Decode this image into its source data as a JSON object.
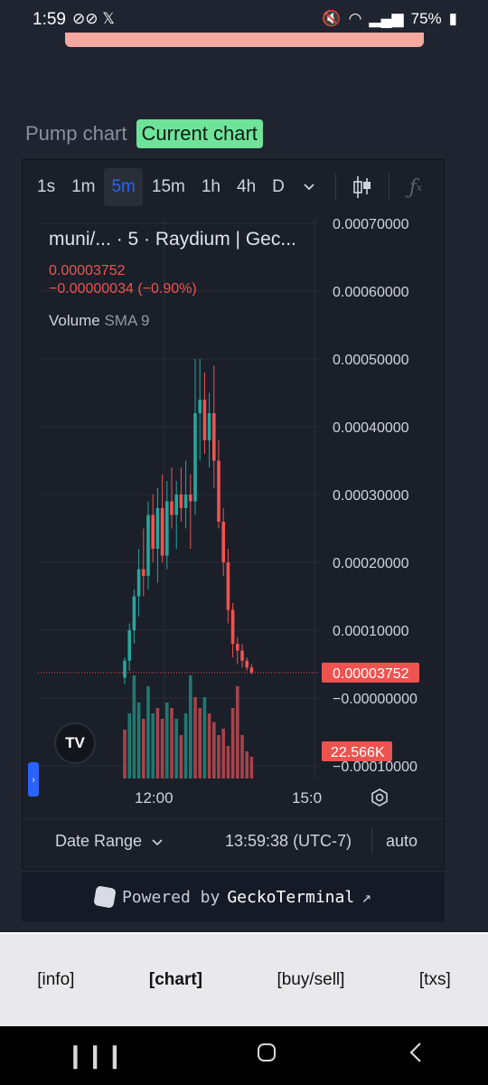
{
  "status_bar": {
    "time": "1:59",
    "battery": "75%"
  },
  "toggle": {
    "pump_label": "Pump chart",
    "current_label": "Current chart"
  },
  "toolbar": {
    "timeframes": [
      "1s",
      "1m",
      "5m",
      "15m",
      "1h",
      "4h",
      "D"
    ],
    "active_timeframe": "5m"
  },
  "legend": {
    "symbol": "muni/... · 5 · Raydium | Gec...",
    "price": "0.00003752",
    "change": "−0.00000034 (−0.90%)",
    "volume_label": "Volume",
    "volume_indicator": "SMA 9"
  },
  "chart_data": {
    "type": "candlestick",
    "interval": "5m",
    "price_axis_ticks": [
      "0.00070000",
      "0.00060000",
      "0.00050000",
      "0.00040000",
      "0.00030000",
      "0.00020000",
      "0.00010000",
      "−0.00000000",
      "−0.00010000"
    ],
    "time_axis_ticks": [
      "12:00",
      "15:0"
    ],
    "last_price_label": "0.00003752",
    "volume_label": "22.566K",
    "colors": {
      "up": "#26a69a",
      "down": "#ef5350",
      "grid": "#2a2e39",
      "background": "#1b1f29"
    },
    "candles": [
      {
        "o": 3e-05,
        "h": 6e-05,
        "l": 2e-05,
        "c": 5.5e-05
      },
      {
        "o": 5.5e-05,
        "h": 0.00011,
        "l": 4e-05,
        "c": 0.0001
      },
      {
        "o": 0.0001,
        "h": 0.00016,
        "l": 8e-05,
        "c": 0.00015
      },
      {
        "o": 0.00015,
        "h": 0.00022,
        "l": 0.00012,
        "c": 0.00019
      },
      {
        "o": 0.00019,
        "h": 0.00025,
        "l": 0.00015,
        "c": 0.00018
      },
      {
        "o": 0.00018,
        "h": 0.00029,
        "l": 0.00016,
        "c": 0.00027
      },
      {
        "o": 0.00027,
        "h": 0.0003,
        "l": 0.0002,
        "c": 0.00022
      },
      {
        "o": 0.00022,
        "h": 0.00031,
        "l": 0.00017,
        "c": 0.00028
      },
      {
        "o": 0.00028,
        "h": 0.00033,
        "l": 0.0002,
        "c": 0.00021
      },
      {
        "o": 0.00021,
        "h": 0.00032,
        "l": 0.00019,
        "c": 0.00029
      },
      {
        "o": 0.00029,
        "h": 0.00034,
        "l": 0.00025,
        "c": 0.00027
      },
      {
        "o": 0.00027,
        "h": 0.00032,
        "l": 0.00022,
        "c": 0.0003
      },
      {
        "o": 0.0003,
        "h": 0.00034,
        "l": 0.00026,
        "c": 0.00028
      },
      {
        "o": 0.00028,
        "h": 0.00035,
        "l": 0.00025,
        "c": 0.0003
      },
      {
        "o": 0.0003,
        "h": 0.00033,
        "l": 0.00022,
        "c": 0.00029
      },
      {
        "o": 0.00029,
        "h": 0.0005,
        "l": 0.00027,
        "c": 0.00042
      },
      {
        "o": 0.00042,
        "h": 0.0005,
        "l": 0.00035,
        "c": 0.00044
      },
      {
        "o": 0.00044,
        "h": 0.00048,
        "l": 0.00036,
        "c": 0.00038
      },
      {
        "o": 0.00038,
        "h": 0.00045,
        "l": 0.00034,
        "c": 0.00042
      },
      {
        "o": 0.00042,
        "h": 0.00049,
        "l": 0.00031,
        "c": 0.00035
      },
      {
        "o": 0.00035,
        "h": 0.00038,
        "l": 0.00025,
        "c": 0.00026
      },
      {
        "o": 0.00026,
        "h": 0.00028,
        "l": 0.00018,
        "c": 0.0002
      },
      {
        "o": 0.0002,
        "h": 0.00022,
        "l": 0.00011,
        "c": 0.00013
      },
      {
        "o": 0.00013,
        "h": 0.00014,
        "l": 6e-05,
        "c": 8e-05
      },
      {
        "o": 8e-05,
        "h": 9e-05,
        "l": 5e-05,
        "c": 7e-05
      },
      {
        "o": 7e-05,
        "h": 8e-05,
        "l": 4.5e-05,
        "c": 5.5e-05
      },
      {
        "o": 5.5e-05,
        "h": 6e-05,
        "l": 4e-05,
        "c": 4.5e-05
      },
      {
        "o": 4.5e-05,
        "h": 5e-05,
        "l": 3.5e-05,
        "c": 3.75e-05
      }
    ],
    "volume": [
      {
        "v": 0.45,
        "up": false
      },
      {
        "v": 0.6,
        "up": true
      },
      {
        "v": 0.95,
        "up": true
      },
      {
        "v": 0.7,
        "up": true
      },
      {
        "v": 0.55,
        "up": false
      },
      {
        "v": 0.85,
        "up": true
      },
      {
        "v": 0.6,
        "up": true
      },
      {
        "v": 0.65,
        "up": false
      },
      {
        "v": 0.55,
        "up": false
      },
      {
        "v": 0.7,
        "up": true
      },
      {
        "v": 0.65,
        "up": false
      },
      {
        "v": 0.55,
        "up": true
      },
      {
        "v": 0.4,
        "up": false
      },
      {
        "v": 0.6,
        "up": true
      },
      {
        "v": 0.95,
        "up": true
      },
      {
        "v": 0.75,
        "up": false
      },
      {
        "v": 0.65,
        "up": false
      },
      {
        "v": 0.75,
        "up": true
      },
      {
        "v": 0.6,
        "up": false
      },
      {
        "v": 0.52,
        "up": false
      },
      {
        "v": 0.4,
        "up": false
      },
      {
        "v": 0.46,
        "up": false
      },
      {
        "v": 0.3,
        "up": false
      },
      {
        "v": 0.65,
        "up": false
      },
      {
        "v": 0.85,
        "up": false
      },
      {
        "v": 0.4,
        "up": false
      },
      {
        "v": 0.25,
        "up": false
      },
      {
        "v": 0.2,
        "up": false
      }
    ]
  },
  "time_axis": {
    "tick_1": "12:00",
    "tick_2": "15:0"
  },
  "bottom": {
    "date_range": "Date Range",
    "clock": "13:59:38 (UTC-7)",
    "auto": "auto"
  },
  "powered": {
    "prefix": "Powered by",
    "brand": "GeckoTerminal",
    "arrow": "↗"
  },
  "nav": {
    "info": "[info]",
    "chart": "[chart]",
    "buysell": "[buy/sell]",
    "txs": "[txs]"
  }
}
